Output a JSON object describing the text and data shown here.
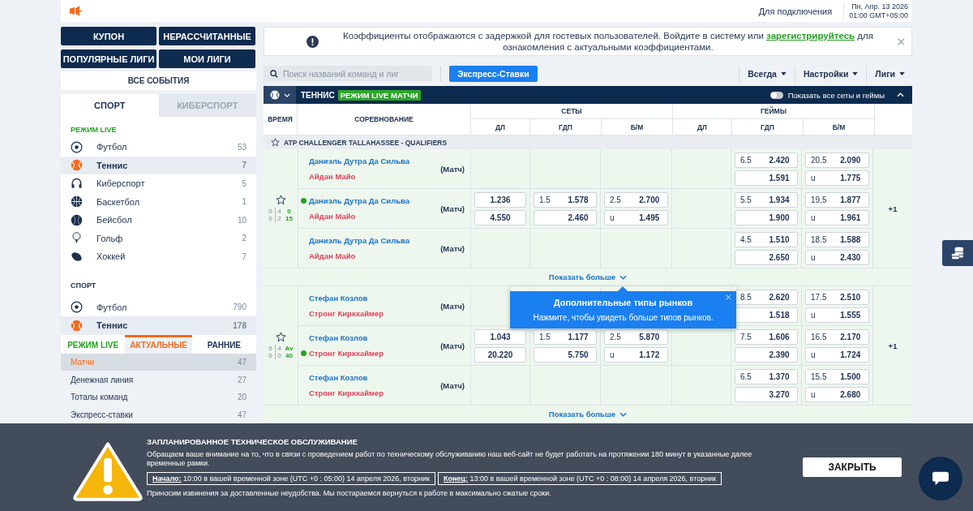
{
  "top_bar": {
    "connect_label": "Для подключения",
    "date": "Пн, Апр. 13 2026",
    "time": "01:00 GMT+05:00"
  },
  "nav_buttons": [
    "КУПОН",
    "НЕРАССЧИТАННЫЕ",
    "ПОПУЛЯРНЫЕ ЛИГИ",
    "МОИ ЛИГИ"
  ],
  "all_events": "ВСЕ СОБЫТИЯ",
  "sidebar_tabs": [
    {
      "label": "СПОРТ",
      "selected": true
    },
    {
      "label": "КИБЕРСПОРТ",
      "selected": false
    }
  ],
  "live_section": {
    "title": "РЕЖИМ LIVE",
    "items": [
      {
        "kind": "football",
        "name": "Футбол",
        "count": "53",
        "selected": false
      },
      {
        "kind": "tennis",
        "name": "Теннис",
        "count": "7",
        "selected": true
      },
      {
        "kind": "esports",
        "name": "Киберспорт",
        "count": "5",
        "selected": false
      },
      {
        "kind": "basketball",
        "name": "Баскетбол",
        "count": "1",
        "selected": false
      },
      {
        "kind": "baseball",
        "name": "Бейсбол",
        "count": "10",
        "selected": false
      },
      {
        "kind": "golf",
        "name": "Гольф",
        "count": "2",
        "selected": false
      },
      {
        "kind": "hockey",
        "name": "Хоккей",
        "count": "7",
        "selected": false
      }
    ]
  },
  "sport_section": {
    "title": "СПОРТ",
    "items": [
      {
        "kind": "football",
        "name": "Футбол",
        "count": "790",
        "selected": false
      },
      {
        "kind": "tennis",
        "name": "Теннис",
        "count": "178",
        "selected": true
      }
    ]
  },
  "mode_tabs": [
    {
      "label": "РЕЖИМ LIVE",
      "kind": "live",
      "selected": false
    },
    {
      "label": "АКТУАЛЬНЫЕ",
      "kind": "plain",
      "selected": true
    },
    {
      "label": "РАННИЕ",
      "kind": "plain",
      "selected": false
    }
  ],
  "markets": [
    {
      "name": "Матчи",
      "count": "47",
      "selected": true
    },
    {
      "name": "Денежная линия",
      "count": "27",
      "selected": false
    },
    {
      "name": "Тоталы команд",
      "count": "20",
      "selected": false
    },
    {
      "name": "Экспресс-ставки",
      "count": "47",
      "selected": false
    }
  ],
  "notice": {
    "before": "Коэффициенты отображаются с задержкой для гостевых пользователей. Войдите в систему или ",
    "link": "зарегистрируйтесь",
    "after": " для ознакомления с актуальными коэффициентами."
  },
  "toolbar": {
    "search_placeholder": "Поиск названий команд и лиг",
    "express_button": "Экспресс-Ставки",
    "dropdowns": [
      "Всегда",
      "Настройки",
      "Лиги"
    ]
  },
  "sport_bar": {
    "title": "ТЕННИС",
    "badge": "РЕЖИМ LIVE МАТЧИ",
    "toggle_label": "Показать все сеты и геймы",
    "toggle_on": false
  },
  "table": {
    "time_header": "ВРЕМЯ",
    "competition_header": "СОРЕВНОВАНИЕ",
    "groups": [
      {
        "title": "СЕТЫ",
        "columns": [
          "ДЛ",
          "ГДП",
          "Б/М"
        ]
      },
      {
        "title": "ГЕЙМЫ",
        "columns": [
          "ДЛ",
          "ГДП",
          "Б/М"
        ]
      }
    ],
    "leagues": [
      {
        "title": "ATP CHALLENGER TALLAHASSEE - QUALIFIERS",
        "matches": [
          {
            "score": [
              [
                "0",
                "4",
                "0"
              ],
              [
                "0",
                "2",
                "15"
              ]
            ],
            "more": "+1",
            "show_more": "Показать больше",
            "rows": [
              {
                "home": "Даниэль Дутра Да Сильва",
                "away": "Айдан Майо",
                "home_serving": false,
                "away_serving": false,
                "market": "(Матч)",
                "games": [
                  [
                    {
                      "line": "6.5",
                      "odd": "2.420"
                    },
                    {
                      "odd": "1.591"
                    }
                  ],
                  [
                    {
                      "line": "20.5",
                      "odd": "2.090"
                    },
                    {
                      "line": "u",
                      "odd": "1.775"
                    }
                  ]
                ]
              },
              {
                "home": "Даниэль Дутра Да Сильва",
                "away": "Айдан Майо",
                "home_serving": true,
                "away_serving": false,
                "market": "(Матч)",
                "sets": [
                  [
                    {
                      "odd": "1.236"
                    },
                    {
                      "odd": "4.550"
                    }
                  ],
                  [
                    {
                      "line": "1.5",
                      "odd": "1.578"
                    },
                    {
                      "odd": "2.460"
                    }
                  ],
                  [
                    {
                      "line": "2.5",
                      "odd": "2.700"
                    },
                    {
                      "line": "u",
                      "odd": "1.495"
                    }
                  ]
                ],
                "games": [
                  [
                    {
                      "line": "5.5",
                      "odd": "1.934"
                    },
                    {
                      "odd": "1.900"
                    }
                  ],
                  [
                    {
                      "line": "19.5",
                      "odd": "1.877"
                    },
                    {
                      "line": "u",
                      "odd": "1.961"
                    }
                  ]
                ]
              },
              {
                "home": "Даниэль Дутра Да Сильва",
                "away": "Айдан Майо",
                "home_serving": false,
                "away_serving": false,
                "market": "(Матч)",
                "games": [
                  [
                    {
                      "line": "4.5",
                      "odd": "1.510"
                    },
                    {
                      "odd": "2.650"
                    }
                  ],
                  [
                    {
                      "line": "18.5",
                      "odd": "1.588"
                    },
                    {
                      "line": "u",
                      "odd": "2.430"
                    }
                  ]
                ]
              }
            ]
          },
          {
            "score": [
              [
                "0",
                "4",
                "Av"
              ],
              [
                "0",
                "0",
                "40"
              ]
            ],
            "more": "+1",
            "show_more": "Показать больше",
            "rows": [
              {
                "home": "Стефан Козлов",
                "away": "Стронг Киркхаймер",
                "home_serving": false,
                "away_serving": false,
                "market": "(Матч)",
                "games": [
                  [
                    {
                      "line": "8.5",
                      "odd": "2.620"
                    },
                    {
                      "odd": "1.518"
                    }
                  ],
                  [
                    {
                      "line": "17.5",
                      "odd": "2.510"
                    },
                    {
                      "line": "u",
                      "odd": "1.555"
                    }
                  ]
                ]
              },
              {
                "home": "Стефан Козлов",
                "away": "Стронг Киркхаймер",
                "home_serving": false,
                "away_serving": true,
                "market": "(Матч)",
                "sets": [
                  [
                    {
                      "odd": "1.043"
                    },
                    {
                      "odd": "20.220"
                    }
                  ],
                  [
                    {
                      "line": "1.5",
                      "odd": "1.177"
                    },
                    {
                      "odd": "5.750"
                    }
                  ],
                  [
                    {
                      "line": "2.5",
                      "odd": "5.870"
                    },
                    {
                      "line": "u",
                      "odd": "1.172"
                    }
                  ]
                ],
                "games": [
                  [
                    {
                      "line": "7.5",
                      "odd": "1.606"
                    },
                    {
                      "odd": "2.390"
                    }
                  ],
                  [
                    {
                      "line": "16.5",
                      "odd": "2.170"
                    },
                    {
                      "line": "u",
                      "odd": "1.724"
                    }
                  ]
                ]
              },
              {
                "home": "Стефан Козлов",
                "away": "Стронг Киркхаймер",
                "home_serving": false,
                "away_serving": false,
                "market": "(Матч)",
                "games": [
                  [
                    {
                      "line": "6.5",
                      "odd": "1.370"
                    },
                    {
                      "odd": "3.270"
                    }
                  ],
                  [
                    {
                      "line": "15.5",
                      "odd": "1.500"
                    },
                    {
                      "line": "u",
                      "odd": "2.680"
                    }
                  ]
                ]
              }
            ]
          }
        ]
      }
    ]
  },
  "tooltip": {
    "title": "Дополнительные типы рынков",
    "text": "Нажмите, чтобы увидеть больше типов рынков."
  },
  "maintenance": {
    "title": "ЗАПЛАНИРОВАННОЕ ТЕХНИЧЕСКОЕ ОБСЛУЖИВАНИЕ",
    "text": "Обращаем ваше внимание на то, что в связи с проведением работ по техническому обслуживанию наш веб-сайт не будет работать на протяжении 180 минут в указанные далее временные рамки.",
    "periods": [
      "**Начало:** 10:00 в вашей временной зоне (UTC +0 : 05:00) 14 апреля 2026, вторник",
      "**Конец:** 13:00 в вашей временной зоне (UTC +0 : 08:00) 14 апреля 2026, вторник"
    ],
    "apology": "Приносим извинения за доставленные неудобства. Мы постараемся вернуться к работе в максимально сжатые сроки.",
    "close_button": "ЗАКРЫТЬ"
  }
}
